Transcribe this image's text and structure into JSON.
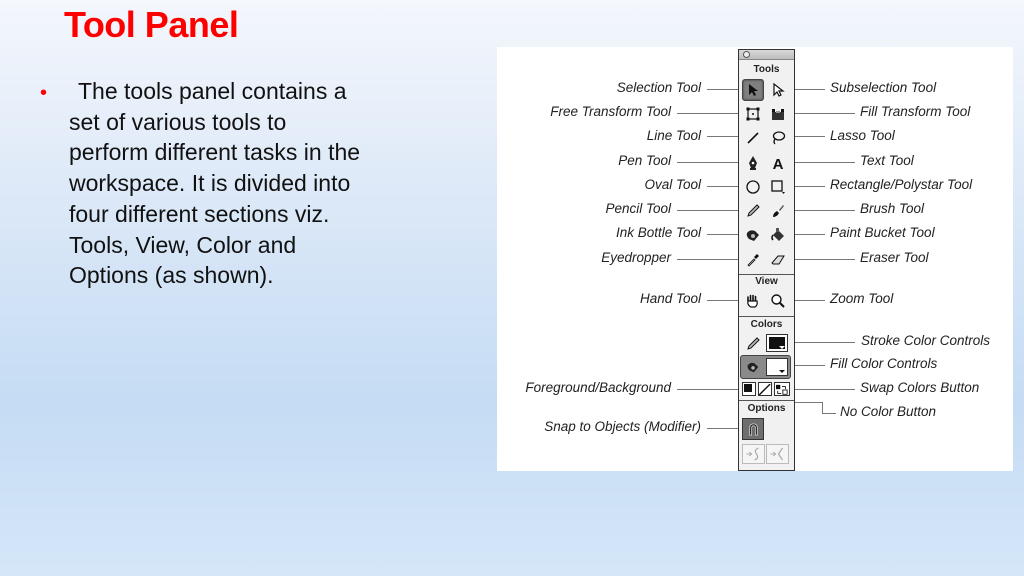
{
  "slide": {
    "title": "Tool Panel",
    "bullet": "The tools panel contains a set of various tools to perform different tasks in the workspace. It is divided into four different sections viz. Tools, View, Color and Options (as shown)."
  },
  "panel": {
    "sections": {
      "tools": "Tools",
      "view": "View",
      "colors": "Colors",
      "options": "Options"
    },
    "stroke_color": "#111111",
    "fill_color": "#ffffff"
  },
  "labels_left": [
    "Selection Tool",
    "Free Transform Tool",
    "Line Tool",
    "Pen Tool",
    "Oval Tool",
    "Pencil Tool",
    "Ink Bottle Tool",
    "Eyedropper",
    "Hand Tool",
    "Foreground/Background",
    "Snap to Objects (Modifier)"
  ],
  "labels_right": [
    "Subselection Tool",
    "Fill Transform Tool",
    "Lasso Tool",
    "Text Tool",
    "Rectangle/Polystar Tool",
    "Brush Tool",
    "Paint Bucket Tool",
    "Eraser Tool",
    "Zoom Tool",
    "Stroke Color Controls",
    "Fill Color Controls",
    "Swap Colors Button",
    "No Color Button"
  ],
  "colors": {
    "title": "#ff0000",
    "bullet": "#ff0000",
    "text": "#111111"
  }
}
